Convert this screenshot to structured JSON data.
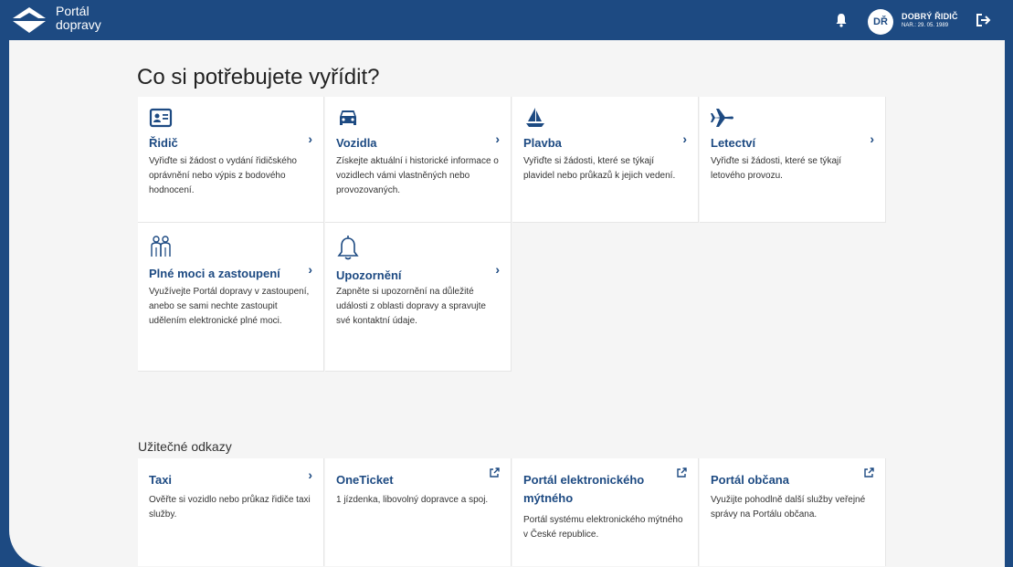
{
  "header": {
    "brand_line1": "Portál",
    "brand_line2": "dopravy",
    "avatar_initials": "DŘ",
    "user_name": "DOBRÝ ŘIDIČ",
    "user_dob": "NAR.: 29. 05. 1989"
  },
  "main": {
    "heading": "Co si potřebujete vyřídit?",
    "cards": [
      {
        "icon": "id-card-icon",
        "title": "Řidič",
        "desc": "Vyřiďte si žádost o vydání řidičského oprávnění nebo výpis z bodového hodnocení."
      },
      {
        "icon": "car-icon",
        "title": "Vozidla",
        "desc": "Získejte aktuální i historické informace o vozidlech vámi vlastněných nebo provozovaných."
      },
      {
        "icon": "sailboat-icon",
        "title": "Plavba",
        "desc": "Vyřiďte si žádosti, které se týkají plavidel nebo průkazů k jejich vedení."
      },
      {
        "icon": "airplane-icon",
        "title": "Letectví",
        "desc": "Vyřiďte si žádosti, které se týkají letového provozu."
      },
      {
        "icon": "people-icon",
        "title": "Plné moci a zastoupení",
        "desc": "Využívejte Portál dopravy v zastoupení, anebo se sami nechte zastoupit udělením elektronické plné moci."
      },
      {
        "icon": "bell-outline-icon",
        "title": "Upozornění",
        "desc": "Zapněte si upozornění na důležité události z oblasti dopravy a spravujte své kontaktní údaje."
      }
    ],
    "links_heading": "Užitečné odkazy",
    "links": [
      {
        "title": "Taxi",
        "desc": "Ověřte si vozidlo nebo průkaz řidiče taxi služby."
      },
      {
        "title": "OneTicket",
        "desc": "1 jízdenka, libovolný dopravce a spoj."
      },
      {
        "title": "Portál elektronického mýtného",
        "desc": "Portál systému elektronického mýtného v České republice."
      },
      {
        "title": "Portál občana",
        "desc": "Využijte pohodlně další služby veřejné správy na Portálu občana."
      }
    ]
  }
}
